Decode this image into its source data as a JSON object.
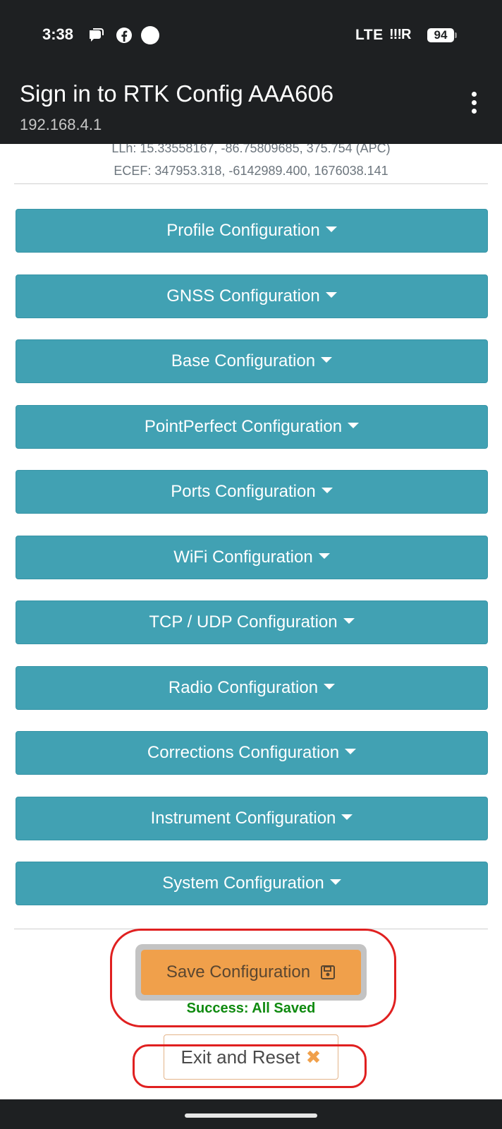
{
  "status_bar": {
    "time": "3:38",
    "network": "LTE",
    "signal": "!!!R",
    "battery": "94"
  },
  "app_bar": {
    "title": "Sign in to RTK Config AAA606",
    "subtitle": "192.168.4.1"
  },
  "position": {
    "llh": "LLh: 15.33558167, -86.75809685, 375.754 (APC)",
    "ecef": "ECEF: 347953.318, -6142989.400, 1676038.141"
  },
  "sections": [
    {
      "label": "Profile Configuration"
    },
    {
      "label": "GNSS Configuration"
    },
    {
      "label": "Base Configuration"
    },
    {
      "label": "PointPerfect Configuration"
    },
    {
      "label": "Ports Configuration"
    },
    {
      "label": "WiFi Configuration"
    },
    {
      "label": "TCP / UDP Configuration"
    },
    {
      "label": "Radio Configuration"
    },
    {
      "label": "Corrections Configuration"
    },
    {
      "label": "Instrument Configuration"
    },
    {
      "label": "System Configuration"
    }
  ],
  "actions": {
    "save_label": "Save Configuration",
    "save_status": "Success: All Saved",
    "exit_label": "Exit and Reset"
  },
  "colors": {
    "section_button": "#41a1b3",
    "save_button": "#f0a04b",
    "success_text": "#0f8a0f",
    "highlight": "#e02020"
  }
}
